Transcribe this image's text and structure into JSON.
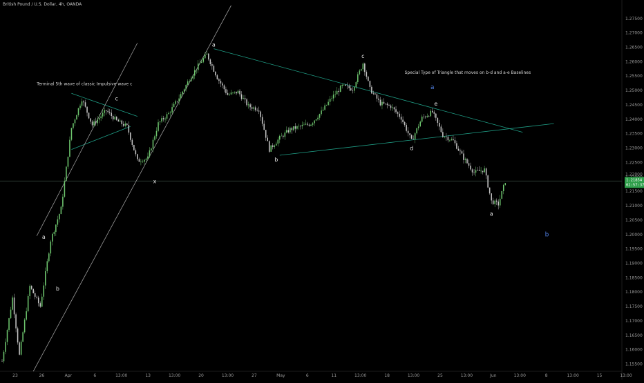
{
  "header": {
    "symbol_title": "British Pound / U.S. Dollar, 4h, OANDA"
  },
  "colors": {
    "background": "#000000",
    "up_candle": "#6ec56e",
    "down_candle": "#c4c4c4",
    "trendline_teal": "#1f9e86",
    "trendline_white": "#9a9a9a",
    "label_blue": "#4f7fe0",
    "price_badge": "#2e9e4a",
    "current_price_line": "#2b3a33"
  },
  "chart_data": {
    "type": "candlestick",
    "title": "British Pound / U.S. Dollar, 4h, OANDA",
    "xlabel": "",
    "ylabel": "",
    "ylim": [
      1.1525,
      1.2795
    ],
    "x_tick_labels": [
      "23",
      "26",
      "Apr",
      "6",
      "13:00",
      "13",
      "13:00",
      "20",
      "13:00",
      "27",
      "May",
      "6",
      "11",
      "13:00",
      "18",
      "13:00",
      "25",
      "13:00",
      "Jun",
      "13:00",
      "8",
      "13:00",
      "15",
      "13:00"
    ],
    "y_tick_labels": [
      "1.27500",
      "1.27000",
      "1.26500",
      "1.26000",
      "1.25500",
      "1.25000",
      "1.24500",
      "1.24000",
      "1.23500",
      "1.23000",
      "1.22500",
      "1.22000",
      "1.21500",
      "1.21000",
      "1.20500",
      "1.20000",
      "1.19500",
      "1.19000",
      "1.18500",
      "1.18000",
      "1.17500",
      "1.17000",
      "1.16500",
      "1.16000",
      "1.15500"
    ],
    "current_price": {
      "value": 1.21854,
      "label": "1.21854",
      "countdown": "02:57:37",
      "sub_label": "1.22000"
    },
    "price_path": [
      {
        "t": 0,
        "p": 1.156
      },
      {
        "t": 3,
        "p": 1.178
      },
      {
        "t": 5,
        "p": 1.158
      },
      {
        "t": 8,
        "p": 1.182
      },
      {
        "t": 11,
        "p": 1.175
      },
      {
        "t": 14,
        "p": 1.198
      },
      {
        "t": 17,
        "p": 1.209
      },
      {
        "t": 20,
        "p": 1.237
      },
      {
        "t": 23,
        "p": 1.247
      },
      {
        "t": 26,
        "p": 1.238
      },
      {
        "t": 30,
        "p": 1.243
      },
      {
        "t": 33,
        "p": 1.2395
      },
      {
        "t": 36,
        "p": 1.2375
      },
      {
        "t": 39,
        "p": 1.2255
      },
      {
        "t": 42,
        "p": 1.2265
      },
      {
        "t": 45,
        "p": 1.2385
      },
      {
        "t": 48,
        "p": 1.242
      },
      {
        "t": 51,
        "p": 1.2475
      },
      {
        "t": 54,
        "p": 1.254
      },
      {
        "t": 57,
        "p": 1.2595
      },
      {
        "t": 59,
        "p": 1.2625
      },
      {
        "t": 62,
        "p": 1.2545
      },
      {
        "t": 65,
        "p": 1.2485
      },
      {
        "t": 68,
        "p": 1.2495
      },
      {
        "t": 71,
        "p": 1.2445
      },
      {
        "t": 74,
        "p": 1.2435
      },
      {
        "t": 77,
        "p": 1.2295
      },
      {
        "t": 80,
        "p": 1.2335
      },
      {
        "t": 83,
        "p": 1.2365
      },
      {
        "t": 86,
        "p": 1.2375
      },
      {
        "t": 89,
        "p": 1.2385
      },
      {
        "t": 92,
        "p": 1.2425
      },
      {
        "t": 95,
        "p": 1.2475
      },
      {
        "t": 98,
        "p": 1.2515
      },
      {
        "t": 101,
        "p": 1.2505
      },
      {
        "t": 104,
        "p": 1.2595
      },
      {
        "t": 106,
        "p": 1.2505
      },
      {
        "t": 109,
        "p": 1.2455
      },
      {
        "t": 112,
        "p": 1.2445
      },
      {
        "t": 115,
        "p": 1.2405
      },
      {
        "t": 118,
        "p": 1.2325
      },
      {
        "t": 121,
        "p": 1.2405
      },
      {
        "t": 124,
        "p": 1.2425
      },
      {
        "t": 127,
        "p": 1.2345
      },
      {
        "t": 130,
        "p": 1.2325
      },
      {
        "t": 133,
        "p": 1.2265
      },
      {
        "t": 136,
        "p": 1.2215
      },
      {
        "t": 139,
        "p": 1.2225
      },
      {
        "t": 141,
        "p": 1.2115
      },
      {
        "t": 143,
        "p": 1.2105
      },
      {
        "t": 145,
        "p": 1.2185
      }
    ],
    "wave_labels": [
      {
        "text": "a",
        "t": 12,
        "p": 1.1985,
        "color": "white"
      },
      {
        "text": "b",
        "t": 16,
        "p": 1.1805,
        "color": "white"
      },
      {
        "text": "c",
        "t": 33,
        "p": 1.2465,
        "color": "white"
      },
      {
        "text": "x",
        "t": 44,
        "p": 1.2178,
        "color": "white"
      },
      {
        "text": "a",
        "t": 61,
        "p": 1.2652,
        "color": "white"
      },
      {
        "text": "b",
        "t": 79,
        "p": 1.2253,
        "color": "white"
      },
      {
        "text": "c",
        "t": 104,
        "p": 1.2613,
        "color": "white"
      },
      {
        "text": "d",
        "t": 118,
        "p": 1.2293,
        "color": "white"
      },
      {
        "text": "e",
        "t": 125,
        "p": 1.2447,
        "color": "white"
      },
      {
        "text": "a",
        "t": 124,
        "p": 1.2505,
        "color": "blue"
      },
      {
        "text": "a",
        "t": 141,
        "p": 1.2065,
        "color": "white"
      },
      {
        "text": "b",
        "t": 157,
        "p": 1.1993,
        "color": "blue"
      }
    ],
    "annotations": [
      {
        "text": "Terminal 5th wave of classic Impulsive wave c",
        "t": 10,
        "p": 1.2518
      },
      {
        "text": "Special Type of Triangle that moves on b-d and a-e Baselines",
        "t": 116,
        "p": 1.2558
      }
    ],
    "trendlines": [
      {
        "name": "triangle-a-e",
        "color": "teal",
        "from": {
          "t": 61,
          "p": 1.2645
        },
        "to": {
          "t": 150,
          "p": 1.2355
        }
      },
      {
        "name": "triangle-b-d",
        "color": "teal",
        "from": {
          "t": 80,
          "p": 1.2275
        },
        "to": {
          "t": 159,
          "p": 1.2385
        }
      },
      {
        "name": "terminal-upper",
        "color": "teal",
        "from": {
          "t": 20,
          "p": 1.249
        },
        "to": {
          "t": 39,
          "p": 1.241
        }
      },
      {
        "name": "terminal-lower",
        "color": "teal",
        "from": {
          "t": 20,
          "p": 1.2295
        },
        "to": {
          "t": 37,
          "p": 1.2375
        }
      },
      {
        "name": "steep-support",
        "color": "white",
        "from": {
          "t": 10,
          "p": 1.1995
        },
        "to": {
          "t": 39,
          "p": 1.2665
        }
      },
      {
        "name": "long-support",
        "color": "white",
        "from": {
          "t": 9,
          "p": 1.1525
        },
        "to": {
          "t": 66,
          "p": 1.2795
        }
      }
    ]
  }
}
